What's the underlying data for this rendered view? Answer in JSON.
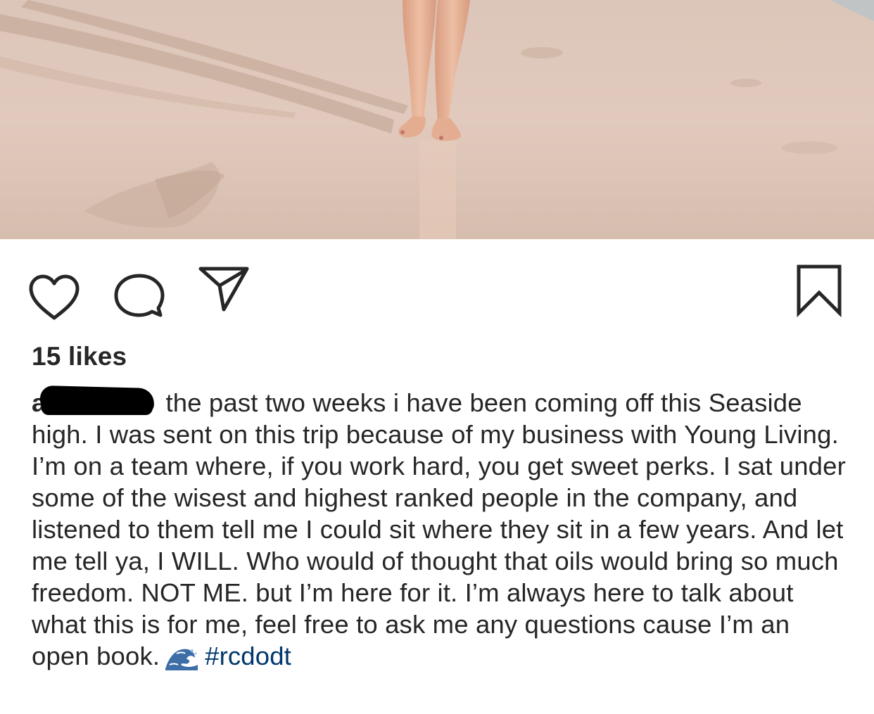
{
  "post": {
    "photo": {
      "alt": "",
      "colors": {
        "sand": "#ddc8bb",
        "sand_shadow": "#c9ac9b",
        "skin": "#e9b89c"
      }
    },
    "actions": {
      "like_icon": "heart-outline-icon",
      "comment_icon": "speech-bubble-icon",
      "share_icon": "paper-plane-icon",
      "save_icon": "bookmark-outline-icon"
    },
    "likes_text": "15 likes",
    "caption": {
      "username": "a",
      "text": "the past two weeks i have been coming off this Seaside high. I was sent on this trip because of my business with Young Living. I’m on a team where, if you work hard, you get sweet perks. I sat under some of the wisest and highest ranked people in the company, and listened to them tell me I could sit where they sit in a few years. And let me tell ya, I WILL. Who would of thought that oils would bring so much freedom. NOT ME. but I’m here for it. I’m always here to talk about what this is for me, feel free to ask me any questions cause I’m an open book.",
      "emoji": "water-wave-emoji",
      "hashtag": "#rcdodt"
    },
    "colors": {
      "text": "#262626",
      "hashtag": "#00376b",
      "icon_stroke": "#262626"
    }
  }
}
